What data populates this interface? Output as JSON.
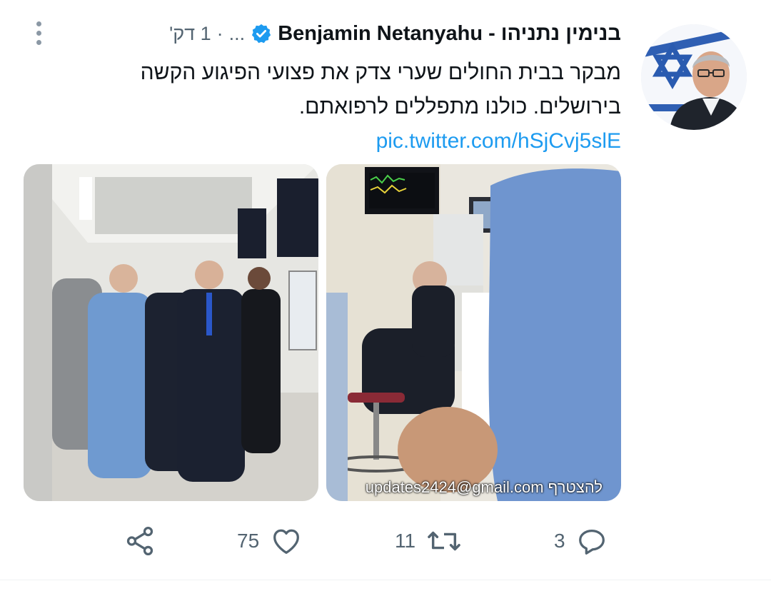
{
  "author": {
    "display_name": "בנימין נתניהו - Benjamin Netanyahu",
    "verified": true
  },
  "timestamp": "1 דק'",
  "separator": "·",
  "truncated": "...",
  "tweet": {
    "text": "מבקר בבית החולים שערי צדק את פצועי הפיגוע הקשה בירושלים. כולנו מתפללים לרפואתם.",
    "link": "pic.twitter.com/hSjCvj5slE"
  },
  "media": {
    "watermark": "להצטרף updates2424@gmail.com"
  },
  "actions": {
    "replies": "3",
    "retweets": "11",
    "likes": "75"
  },
  "icons": {
    "verified": "verified-badge-icon",
    "more": "more-vertical-icon",
    "reply": "reply-icon",
    "retweet": "retweet-icon",
    "like": "heart-icon",
    "share": "share-icon"
  },
  "colors": {
    "link": "#1d9bf0",
    "secondary_text": "#536471",
    "verified": "#1d9bf0"
  }
}
